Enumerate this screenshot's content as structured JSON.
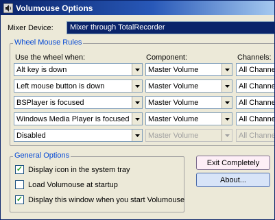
{
  "window": {
    "title": "Volumouse Options"
  },
  "mixer": {
    "label": "Mixer Device:",
    "value": "Mixer through TotalRecorder"
  },
  "rules": {
    "title": "Wheel Mouse Rules",
    "col_use": "Use the wheel when:",
    "col_component": "Component:",
    "col_channels": "Channels:",
    "rows": [
      {
        "condition": "Alt key is down",
        "component": "Master Volume",
        "channels": "All Channels"
      },
      {
        "condition": "Left mouse button is down",
        "component": "Master Volume",
        "channels": "All Channels"
      },
      {
        "condition": "BSPlayer is focused",
        "component": "Master Volume",
        "channels": "All Channels"
      },
      {
        "condition": "Windows Media Player is focused",
        "component": "Master Volume",
        "channels": "All Channels"
      },
      {
        "condition": "Disabled",
        "component": "Master Volume",
        "channels": "All Channels"
      }
    ]
  },
  "general": {
    "title": "General Options",
    "options": [
      {
        "label": "Display icon in the system tray",
        "checked": true
      },
      {
        "label": "Load Volumouse at startup",
        "checked": false
      },
      {
        "label": "Display this window when you start Volumouse",
        "checked": true
      }
    ]
  },
  "buttons": {
    "exit": "Exit Completely",
    "about": "About..."
  },
  "colors": {
    "title_bar": "#0a246a",
    "selection": "#0a246a",
    "group_title": "#0046d5"
  }
}
